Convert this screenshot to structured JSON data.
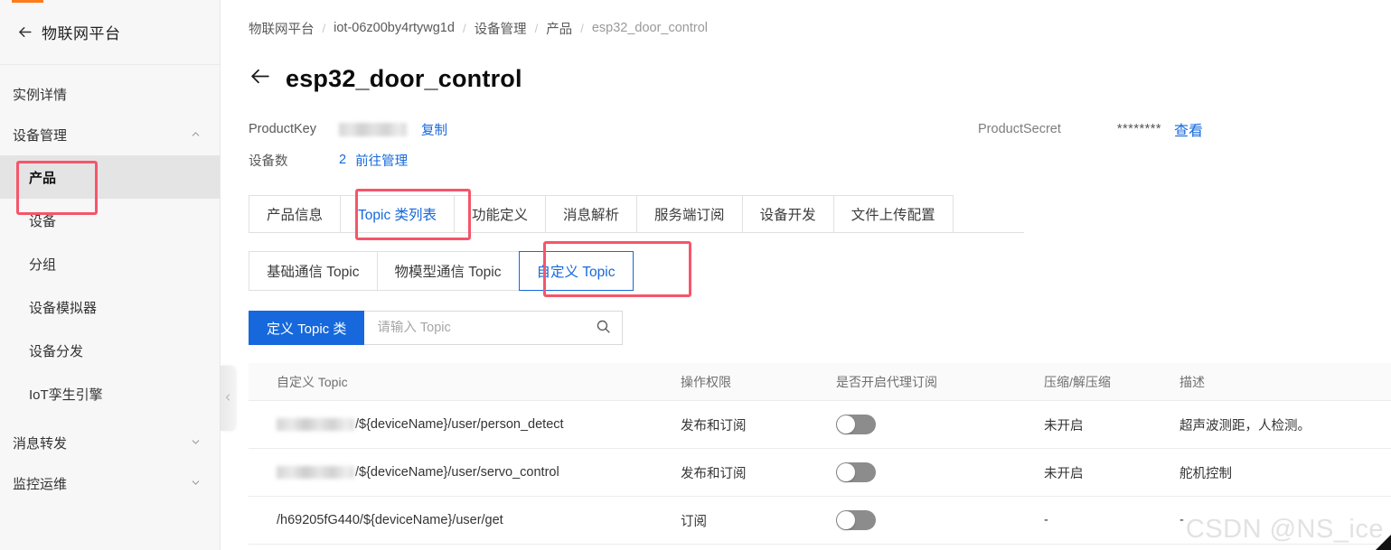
{
  "sidebar": {
    "back_icon": "arrow-left-icon",
    "title": "物联网平台",
    "items": [
      {
        "label": "实例详情",
        "type": "group",
        "chevron": ""
      },
      {
        "label": "设备管理",
        "type": "group",
        "chevron": "⌃"
      },
      {
        "label": "产品",
        "type": "item",
        "active": true
      },
      {
        "label": "设备",
        "type": "item",
        "active": false
      },
      {
        "label": "分组",
        "type": "item",
        "active": false
      },
      {
        "label": "设备模拟器",
        "type": "item",
        "active": false
      },
      {
        "label": "设备分发",
        "type": "item",
        "active": false
      },
      {
        "label": "IoT孪生引擎",
        "type": "item",
        "active": false
      },
      {
        "label": "消息转发",
        "type": "group",
        "chevron": "⌄"
      },
      {
        "label": "监控运维",
        "type": "group",
        "chevron": "⌄"
      }
    ],
    "collapse_icon": "chevron-left-icon"
  },
  "breadcrumb": {
    "separator": "/",
    "items": [
      "物联网平台",
      "iot-06z00by4rtywg1d",
      "设备管理",
      "产品",
      "esp32_door_control"
    ]
  },
  "header": {
    "back_icon": "arrow-left-icon",
    "title": "esp32_door_control",
    "product_key_label": "ProductKey",
    "product_key_value": "",
    "copy_label": "复制",
    "device_count_label": "设备数",
    "device_count_value": "2",
    "goto_manage_label": "前往管理",
    "product_secret_label": "ProductSecret",
    "product_secret_value": "********",
    "view_label": "查看"
  },
  "tabs": [
    {
      "label": "产品信息",
      "active": false
    },
    {
      "label": "Topic 类列表",
      "active": true
    },
    {
      "label": "功能定义",
      "active": false
    },
    {
      "label": "消息解析",
      "active": false
    },
    {
      "label": "服务端订阅",
      "active": false
    },
    {
      "label": "设备开发",
      "active": false
    },
    {
      "label": "文件上传配置",
      "active": false
    }
  ],
  "subtabs": [
    {
      "label": "基础通信 Topic",
      "active": false
    },
    {
      "label": "物模型通信 Topic",
      "active": false
    },
    {
      "label": "自定义 Topic",
      "active": true
    }
  ],
  "toolbar": {
    "define_button_label": "定义 Topic 类",
    "search_placeholder": "请输入 Topic",
    "search_value": "",
    "search_icon": "search-icon"
  },
  "table": {
    "columns": [
      "自定义 Topic",
      "操作权限",
      "是否开启代理订阅",
      "压缩/解压缩",
      "描述"
    ],
    "rows": [
      {
        "topic_masked": true,
        "topic": "/${deviceName}/user/person_detect",
        "permission": "发布和订阅",
        "proxy_subscribe": false,
        "compression": "未开启",
        "description": "超声波测距，人检测。"
      },
      {
        "topic_masked": true,
        "topic": "/${deviceName}/user/servo_control",
        "permission": "发布和订阅",
        "proxy_subscribe": false,
        "compression": "未开启",
        "description": "舵机控制"
      },
      {
        "topic_masked": false,
        "topic": "/h69205fG440/${deviceName}/user/get",
        "permission": "订阅",
        "proxy_subscribe": false,
        "compression": "-",
        "description": "-"
      }
    ]
  },
  "annotations": {
    "color": "#f5566a",
    "boxes": [
      "产品",
      "Topic 类列表",
      "自定义 Topic"
    ]
  },
  "watermark": "CSDN @NS_ice",
  "accent_color": "#1668dc",
  "loadbar_color": "#ff7b1c"
}
